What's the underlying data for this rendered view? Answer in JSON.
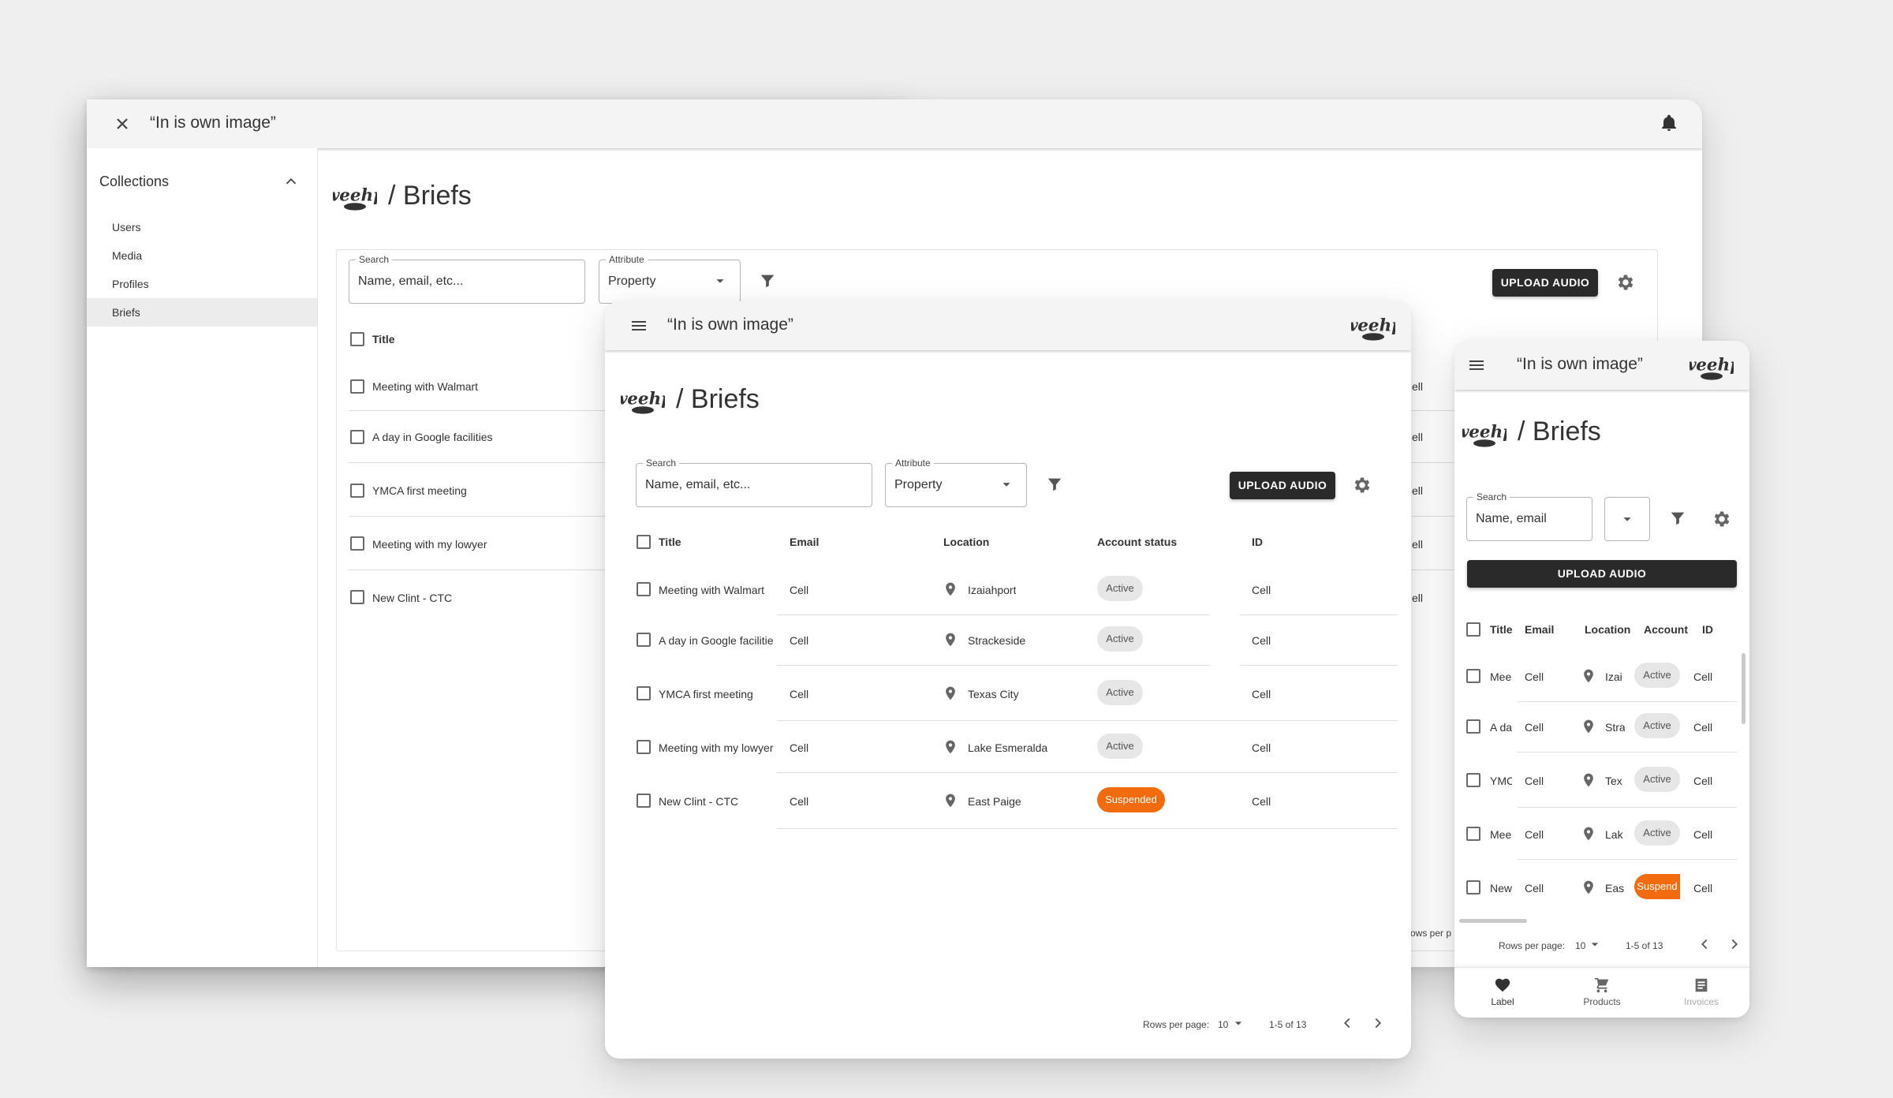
{
  "app_title": "“In is own image”",
  "breadcrumb": "/ Briefs",
  "logo_text": "weehp",
  "sidebar": {
    "section_label": "Collections",
    "items": [
      "Users",
      "Media",
      "Profiles",
      "Briefs"
    ]
  },
  "search": {
    "label": "Search",
    "value": "Name, email, etc...",
    "value_short": "Name, email"
  },
  "attribute": {
    "label": "Attribute",
    "value": "Property"
  },
  "upload_label": "UPLOAD AUDIO",
  "columns": {
    "title": "Title",
    "email": "Email",
    "location": "Location",
    "status": "Account status",
    "status_short": "Account s",
    "id": "ID"
  },
  "rows": [
    {
      "title": "Meeting with Walmart",
      "title_mid": "Meeting with Walmart",
      "title_short": "Mee",
      "email": "Cell",
      "location": "Izaiahport",
      "location_short": "Izai",
      "status": "Active",
      "status_short": "Active",
      "id": "Cell"
    },
    {
      "title": "A day in Google facilities",
      "title_mid": "A day in Google facilitie",
      "title_short": "A da",
      "email": "Cell",
      "location": "Strackeside",
      "location_short": "Stra",
      "status": "Active",
      "status_short": "Active",
      "id": "Cell"
    },
    {
      "title": "YMCA first meeting",
      "title_mid": "YMCA first meeting",
      "title_short": "YMC",
      "email": "Cell",
      "location": "Texas City",
      "location_short": "Tex",
      "status": "Active",
      "status_short": "Active",
      "id": "Cell"
    },
    {
      "title": "Meeting with my lowyer",
      "title_mid": "Meeting with my lowyer",
      "title_short": "Mee",
      "email": "Cell",
      "location": "Lake Esmeralda",
      "location_short": "Lak",
      "status": "Active",
      "status_short": "Active",
      "id": "Cell"
    },
    {
      "title": "New Clint - CTC",
      "title_mid": "New Clint - CTC",
      "title_short": "New",
      "email": "Cell",
      "location": "East Paige",
      "location_short": "Eas",
      "status": "Suspended",
      "status_short": "Suspend",
      "id": "Cell"
    }
  ],
  "peek": {
    "cell": "ell",
    "rows_per_page_fragment": "ows per p"
  },
  "pagination": {
    "rows_per_page_label": "Rows per page:",
    "rows_per_page_value": "10",
    "range": "1-5 of 13"
  },
  "bottom_nav": [
    {
      "label": "Label",
      "icon": "heart-icon",
      "active": true
    },
    {
      "label": "Products",
      "icon": "cart-icon",
      "active": false
    },
    {
      "label": "Invoices",
      "icon": "document-icon",
      "active": false
    }
  ],
  "colors": {
    "accent_dark": "#2a2a2a",
    "suspended": "#f26b0f",
    "active_chip": "#e6e6e6"
  }
}
